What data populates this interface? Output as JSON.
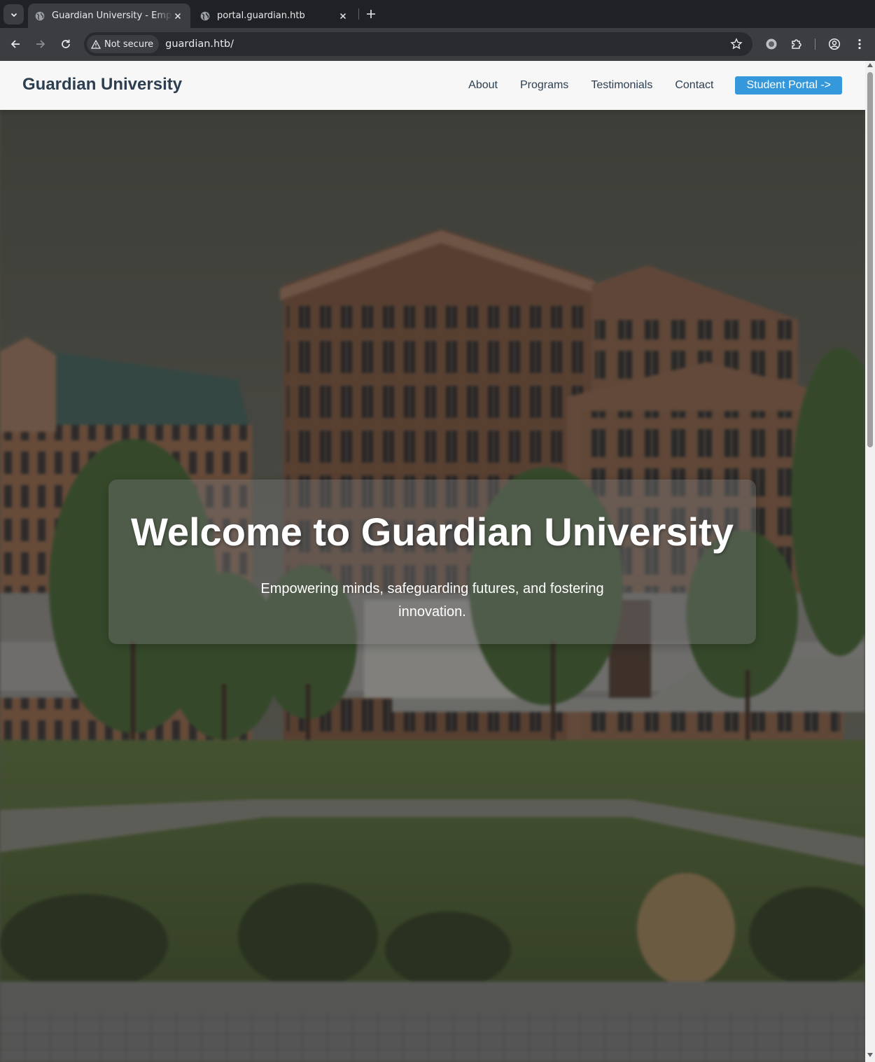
{
  "browser": {
    "tabs": [
      {
        "title": "Guardian University - Empowering minds",
        "active": true
      },
      {
        "title": "portal.guardian.htb",
        "active": false
      }
    ],
    "security_label": "Not secure",
    "url": "guardian.htb/"
  },
  "site": {
    "brand": "Guardian University",
    "nav": {
      "about": "About",
      "programs": "Programs",
      "testimonials": "Testimonials",
      "contact": "Contact",
      "portal": "Student Portal ->"
    },
    "hero": {
      "title": "Welcome to Guardian University",
      "subtitle": "Empowering minds, safeguarding futures, and fostering innovation."
    }
  },
  "colors": {
    "brand_text": "#2c3e50",
    "accent": "#3498db",
    "chrome_bg": "#202124",
    "toolbar_bg": "#3c3d41"
  },
  "icons": [
    "tab-search-icon",
    "globe-icon",
    "close-icon",
    "plus-icon",
    "back-icon",
    "forward-icon",
    "reload-icon",
    "warning-icon",
    "star-icon",
    "record-icon",
    "puzzle-icon",
    "profile-icon",
    "kebab-menu-icon"
  ]
}
